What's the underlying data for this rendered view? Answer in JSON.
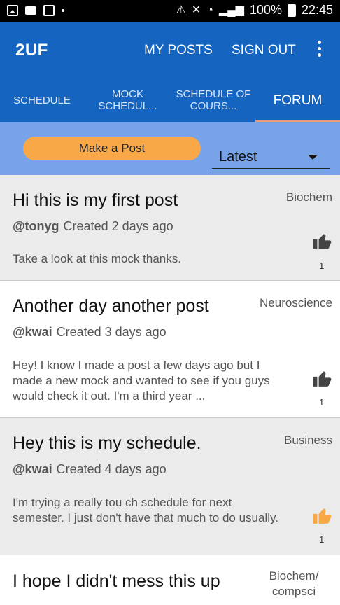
{
  "status_bar": {
    "left_icons": [
      "image-icon",
      "message-icon",
      "checkbox-icon",
      "dot-icon"
    ],
    "right_icons": [
      "nfc-icon",
      "mute-icon",
      "wifi-icon",
      "signal-icon"
    ],
    "battery": "100%",
    "time": "22:45"
  },
  "app_bar": {
    "title": "2UF",
    "actions": [
      "MY POSTS",
      "SIGN OUT"
    ],
    "overflow_icon": "more-vert-icon"
  },
  "tabs": [
    {
      "label": "SCHEDULE"
    },
    {
      "label": "MOCK SCHEDUL..."
    },
    {
      "label": "SCHEDULE OF COURS..."
    },
    {
      "label": "FORUM",
      "selected": true
    }
  ],
  "toolbar": {
    "make_post_label": "Make a Post",
    "sort_value": "Latest"
  },
  "posts": [
    {
      "title": "Hi this is my first post",
      "category": "Biochem",
      "user": "@tonyg",
      "created": "Created 2 days ago",
      "body": "Take a look at this mock thanks.",
      "likes": "1",
      "liked": false
    },
    {
      "title": "Another day another post",
      "category": "Neuroscience",
      "user": "@kwai",
      "created": "Created 3 days ago",
      "body": "Hey! I know I made a post a few days ago but I made a new mock and wanted to see if you guys would check it out. I'm a third year ...",
      "likes": "1",
      "liked": false
    },
    {
      "title": "Hey this is my schedule.",
      "category": "Business",
      "user": "@kwai",
      "created": "Created 4 days ago",
      "body": "I'm trying a really tou ch schedule for next semester. I just don't have that much to do usually.",
      "likes": "1",
      "liked": true
    },
    {
      "title": "I hope I didn't mess this up",
      "category": "Biochem/ compsci"
    }
  ],
  "colors": {
    "primary": "#1565c0",
    "toolbar": "#78a3e8",
    "accent": "#f9a847",
    "tab_indicator": "#ef9a7a",
    "like_default": "#444444",
    "like_active": "#f9a847"
  }
}
